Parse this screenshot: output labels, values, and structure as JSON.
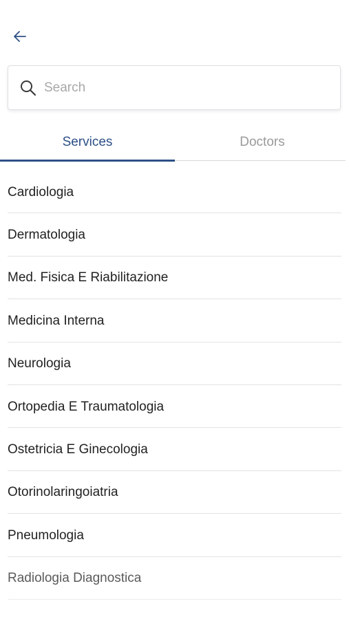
{
  "header": {
    "back_icon": "arrow-left-icon"
  },
  "search": {
    "icon": "search-icon",
    "placeholder": "Search",
    "value": ""
  },
  "tabs": [
    {
      "label": "Services",
      "active": true
    },
    {
      "label": "Doctors",
      "active": false
    }
  ],
  "colors": {
    "accent": "#2c5086",
    "inactive_tab": "#9a9a9a",
    "divider": "#e3e3e3"
  },
  "services": [
    "Cardiologia",
    "Dermatologia",
    "Med. Fisica E Riabilitazione",
    "Medicina Interna",
    "Neurologia",
    "Ortopedia E Traumatologia",
    "Ostetricia E Ginecologia",
    "Otorinolaringoiatria",
    "Pneumologia",
    "Radiologia Diagnostica"
  ]
}
